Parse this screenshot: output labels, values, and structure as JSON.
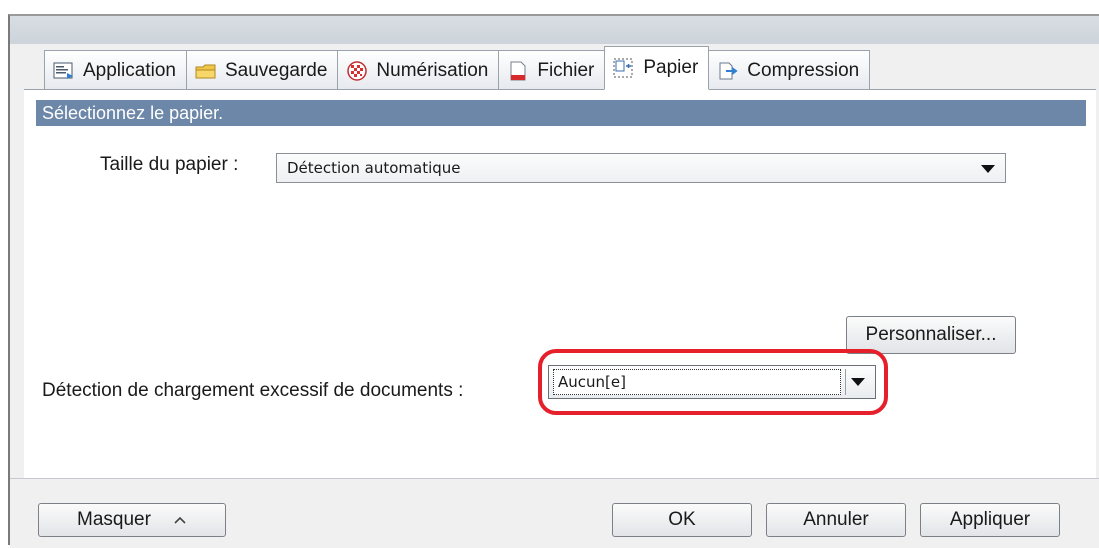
{
  "tabs": [
    {
      "label": "Application",
      "icon": "application-icon"
    },
    {
      "label": "Sauvegarde",
      "icon": "folder-icon"
    },
    {
      "label": "Numérisation",
      "icon": "scan-icon"
    },
    {
      "label": "Fichier",
      "icon": "file-icon"
    },
    {
      "label": "Papier",
      "icon": "paper-icon",
      "active": true
    },
    {
      "label": "Compression",
      "icon": "compression-icon"
    }
  ],
  "panel": {
    "header": "Sélectionnez le papier.",
    "paper_size_label": "Taille du papier :",
    "paper_size_value": "Détection automatique",
    "customize_label": "Personnaliser...",
    "overload_label": "Détection de chargement excessif de documents :",
    "overload_value": "Aucun[e]"
  },
  "footer": {
    "hide_label": "Masquer",
    "ok_label": "OK",
    "cancel_label": "Annuler",
    "apply_label": "Appliquer"
  },
  "colors": {
    "header_bar": "#6c87a8",
    "highlight_ring": "#e5202a"
  }
}
